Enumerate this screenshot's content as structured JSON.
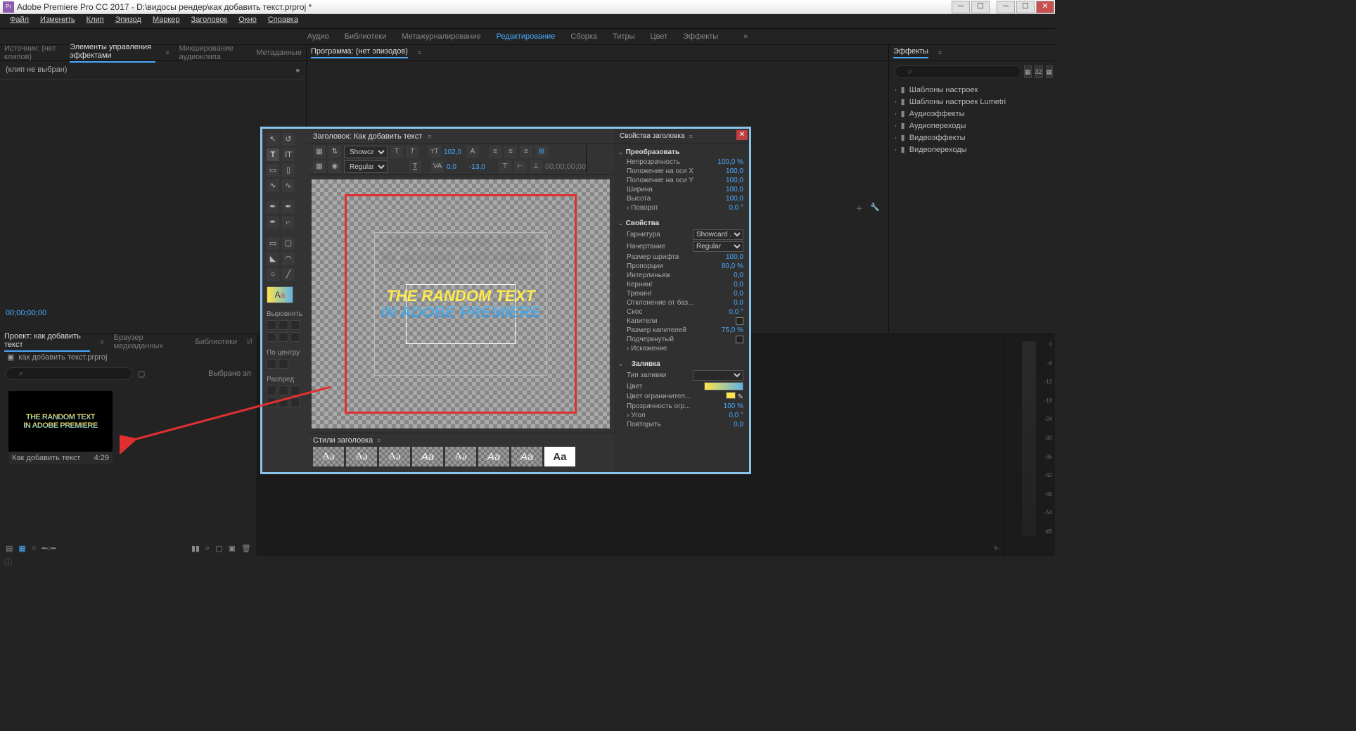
{
  "window": {
    "title": "Adobe Premiere Pro CC 2017 - D:\\видосы рендер\\как добавить текст.prproj *"
  },
  "menubar": [
    "Файл",
    "Изменить",
    "Клип",
    "Эпизод",
    "Маркер",
    "Заголовок",
    "Окно",
    "Справка"
  ],
  "workspaces": [
    "Аудио",
    "Библиотеки",
    "Метажурналирование",
    "Редактирование",
    "Сборка",
    "Титры",
    "Цвет",
    "Эффекты"
  ],
  "workspace_active": "Редактирование",
  "panel_left_tabs": {
    "source": "Источник: (нет клипов)",
    "effects_ctrl": "Элементы управления эффектами",
    "audio_mix": "Микширование аудиоклипа",
    "metadata": "Метаданные"
  },
  "no_clip": "(клип не выбран)",
  "zero_tc": "00;00;00;00",
  "program_tab": "Программа: (нет эпизодов)",
  "effects_tab": "Эффекты",
  "effects_list": [
    "Шаблоны настроек",
    "Шаблоны настроек Lumetri",
    "Аудиоэффекты",
    "Аудиопереходы",
    "Видеоэффекты",
    "Видеопереходы"
  ],
  "project": {
    "tab": "Проект: как добавить текст",
    "tab2": "Браузер медиаданных",
    "tab3": "Библиотеки",
    "tab4": "И",
    "file": "как добавить текст.prproj",
    "selected": "Выбрано эл",
    "clip_name": "Как добавить текст",
    "clip_dur": "4:29",
    "thumb_line1": "THE RANDOM TEXT",
    "thumb_line2": "IN ADOBE PREMIERE"
  },
  "titler": {
    "title": "Заголовок: Как добавить текст",
    "font_family": "Showca...",
    "font_style": "Regular",
    "font_size": "102,0",
    "kerning": "0,0",
    "tracking": "-13,0",
    "tc": "00;00;00;00",
    "align_label": "Выровнять",
    "center_label": "По центру",
    "distribute_label": "Распред",
    "canvas_line1": "THE RANDOM TEXT",
    "canvas_line2": "IN ADOBE PREMIERE",
    "styles_label": "Стили заголовка",
    "props_label": "Свойства заголовка",
    "sections": {
      "transform": "Преобразовать",
      "props": "Свойства",
      "fill": "Заливка"
    },
    "p": {
      "opacity_k": "Непрозрачность",
      "opacity_v": "100,0 %",
      "posx_k": "Положение на оси X",
      "posx_v": "100,0",
      "posy_k": "Положение на оси Y",
      "posy_v": "100,0",
      "width_k": "Ширина",
      "width_v": "100,0",
      "height_k": "Высота",
      "height_v": "100,0",
      "rotation_k": "Поворот",
      "rotation_v": "0,0 °",
      "fontfam_k": "Гарнитура",
      "fontfam_v": "Showcard ...",
      "fontsty_k": "Начертание",
      "fontsty_v": "Regular",
      "fontsize_k": "Размер шрифта",
      "fontsize_v": "100,0",
      "aspect_k": "Пропорции",
      "aspect_v": "80,0 %",
      "leading_k": "Интерлиньяж",
      "leading_v": "0,0",
      "kerning_k": "Кернинг",
      "kerning_v": "0,0",
      "tracking_k": "Трекинг",
      "tracking_v": "0,0",
      "baseline_k": "Отклонение от баз...",
      "baseline_v": "0,0",
      "slant_k": "Скос",
      "slant_v": "0,0 °",
      "smallcaps_k": "Капители",
      "smallcapssize_k": "Размер капителей",
      "smallcapssize_v": "75,0 %",
      "underline_k": "Подчеркнутый",
      "distort_k": "Искажение",
      "filltype_k": "Тип заливки",
      "color_k": "Цвет",
      "strokecolor_k": "Цвет ограничител...",
      "strokeop_k": "Прозрачность огр...",
      "strokeop_v": "100 %",
      "angle_k": "Угол",
      "angle_v": "0,0 °",
      "repeat_k": "Повторить",
      "repeat_v": "0,0"
    }
  },
  "timeline_end": "ь.",
  "audio_scale": [
    "0",
    "-6",
    "-12",
    "-18",
    "-24",
    "-30",
    "-36",
    "-42",
    "-48",
    "-54",
    "dB"
  ]
}
